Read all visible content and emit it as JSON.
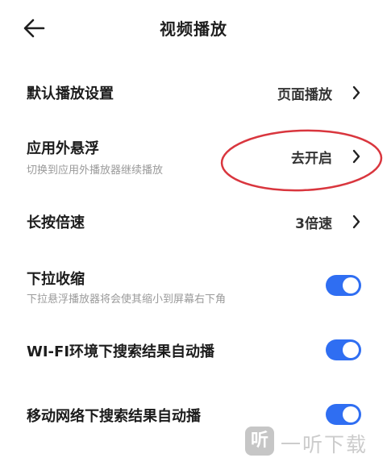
{
  "header": {
    "title": "视频播放",
    "back_icon": "arrow-left-icon"
  },
  "settings": {
    "default_play": {
      "label": "默认播放设置",
      "value": "页面播放"
    },
    "floating_window": {
      "label": "应用外悬浮",
      "subtitle": "切换到应用外播放器继续播放",
      "value": "去开启"
    },
    "long_press_speed": {
      "label": "长按倍速",
      "value": "3倍速"
    },
    "pull_shrink": {
      "label": "下拉收缩",
      "subtitle": "下拉悬浮播放器将会使其缩小到屏幕右下角",
      "enabled": true
    },
    "wifi_autoplay": {
      "label": "WI-FI环境下搜索结果自动播",
      "enabled": true
    },
    "mobile_autoplay": {
      "label": "移动网络下搜索结果自动播",
      "enabled": true
    }
  },
  "colors": {
    "toggle_on": "#2f6ef2",
    "annotation": "#d9363e"
  },
  "watermark": {
    "icon_glyph": "听",
    "text": "一听下载"
  }
}
